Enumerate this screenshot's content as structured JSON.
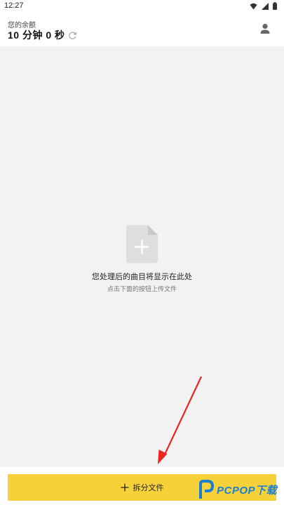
{
  "status_bar": {
    "time": "12:27"
  },
  "header": {
    "balance_label": "您的余额",
    "balance_value": "10 分钟 0 秒"
  },
  "empty_state": {
    "title": "您处理后的曲目将显示在此处",
    "subtitle": "点击下面的按钮上传文件"
  },
  "bottom_bar": {
    "split_button_label": "拆分文件"
  },
  "watermark": {
    "text": "PCPOP下载"
  },
  "colors": {
    "accent": "#f6d13a",
    "background": "#f2f2f2",
    "arrow": "#e8251f",
    "watermark": "#1a7fd0"
  },
  "icons": [
    "wifi-icon",
    "signal-icon",
    "battery-icon",
    "refresh-icon",
    "user-icon",
    "file-add-icon",
    "plus-icon"
  ]
}
